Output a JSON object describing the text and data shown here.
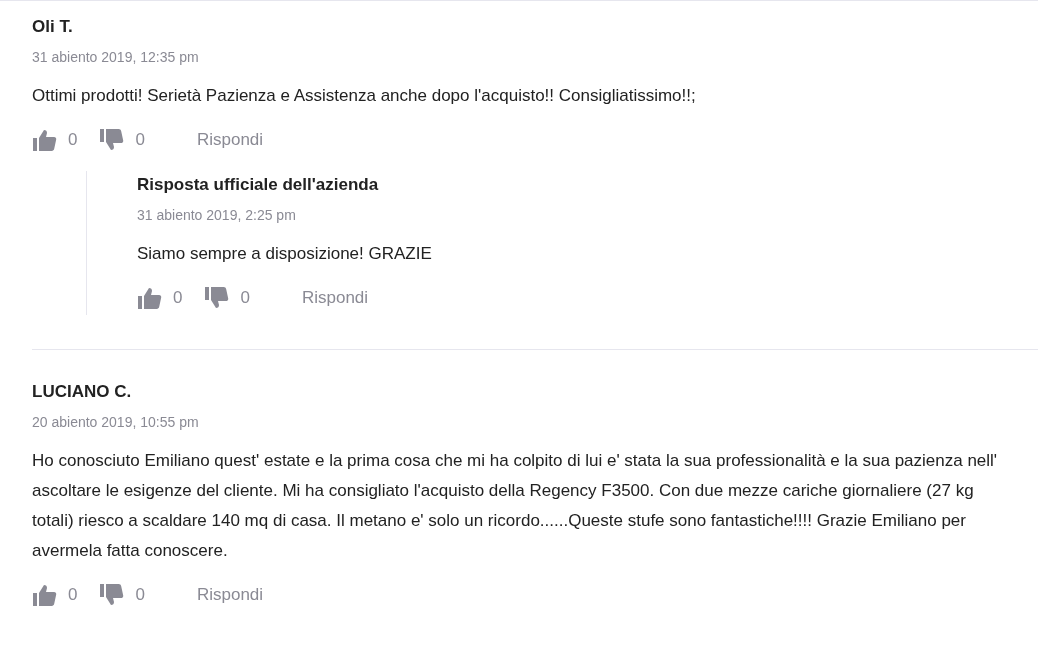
{
  "comments": [
    {
      "author": "Oli T.",
      "date": "31 abiento 2019, 12:35 pm",
      "text": "Ottimi prodotti! Serietà Pazienza e Assistenza anche dopo l'acquisto!! Consigliatissimo!!;",
      "likes": "0",
      "dislikes": "0",
      "reply_label": "Rispondi",
      "replies": [
        {
          "author": "Risposta ufficiale dell'azienda",
          "date": "31 abiento 2019, 2:25 pm",
          "text": "Siamo sempre a disposizione! GRAZIE",
          "likes": "0",
          "dislikes": "0",
          "reply_label": "Rispondi"
        }
      ]
    },
    {
      "author": "LUCIANO C.",
      "date": "20 abiento 2019, 10:55 pm",
      "text": "Ho conosciuto Emiliano quest' estate e la prima cosa che mi ha colpito di lui e' stata la sua professionalità e la sua pazienza nell' ascoltare le esigenze del cliente. Mi ha consigliato l'acquisto della Regency F3500. Con due mezze cariche giornaliere (27 kg totali) riesco a scaldare 140 mq di casa. Il metano e' solo un ricordo......Queste stufe sono fantastiche!!!! Grazie Emiliano per avermela fatta conoscere.",
      "likes": "0",
      "dislikes": "0",
      "reply_label": "Rispondi"
    }
  ]
}
